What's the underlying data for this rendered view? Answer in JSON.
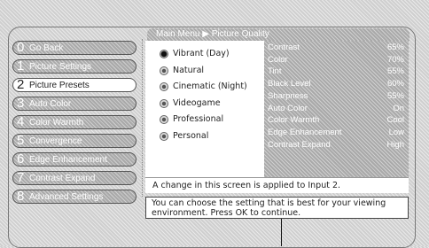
{
  "breadcrumb": "Main Menu ▶ Picture Quality",
  "menu": [
    {
      "num": "0",
      "label": "Go Back"
    },
    {
      "num": "1",
      "label": "Picture Settings"
    },
    {
      "num": "2",
      "label": "Picture Presets",
      "active": true
    },
    {
      "num": "3",
      "label": "Auto Color"
    },
    {
      "num": "4",
      "label": "Color Warmth"
    },
    {
      "num": "5",
      "label": "Convergence"
    },
    {
      "num": "6",
      "label": "Edge Enhancement"
    },
    {
      "num": "7",
      "label": "Contrast Expand"
    },
    {
      "num": "8",
      "label": "Advanced Settings"
    }
  ],
  "presets": [
    {
      "label": "Vibrant (Day)",
      "selected": true
    },
    {
      "label": "Natural"
    },
    {
      "label": "Cinematic (Night)"
    },
    {
      "label": "Videogame"
    },
    {
      "label": "Professional"
    },
    {
      "label": "Personal"
    }
  ],
  "settings": [
    {
      "name": "Contrast",
      "value": "65%"
    },
    {
      "name": "Color",
      "value": "70%"
    },
    {
      "name": "Tint",
      "value": "55%"
    },
    {
      "name": "Black Level",
      "value": "60%"
    },
    {
      "name": "Sharpness",
      "value": "55%"
    },
    {
      "name": "Auto Color",
      "value": "On"
    },
    {
      "name": "Color Warmth",
      "value": "Cool"
    },
    {
      "name": "Edge Enhancement",
      "value": "Low"
    },
    {
      "name": "Contrast Expand",
      "value": "High"
    }
  ],
  "note": "A change in this screen is applied to Input 2.",
  "help": {
    "line1": "You can choose the setting that is best for your viewing",
    "line2": "environment. Press OK to continue."
  }
}
